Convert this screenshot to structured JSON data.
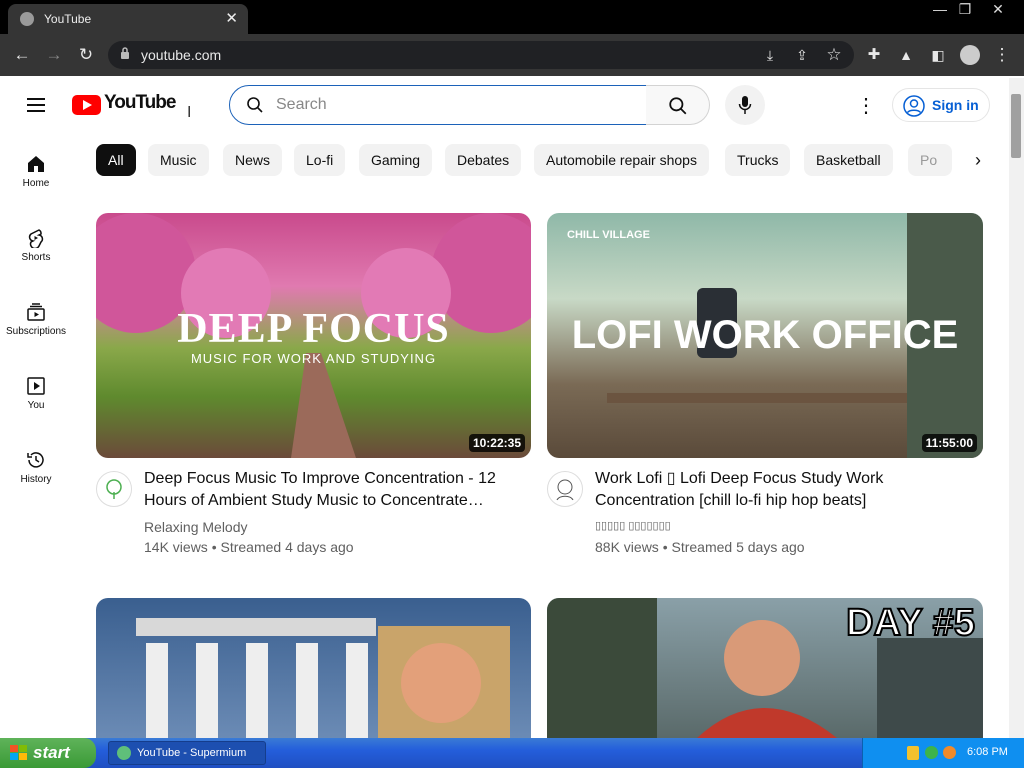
{
  "browser": {
    "tab_title": "YouTube",
    "tab_close": "✕",
    "window_controls": [
      "—",
      "❐",
      "✕"
    ],
    "url": "youtube.com"
  },
  "youtube": {
    "logo_text": "YouTube",
    "search_placeholder": "Search",
    "sign_in": "Sign in"
  },
  "sidebar": {
    "items": [
      {
        "label": "Home",
        "icon": "home-icon"
      },
      {
        "label": "Shorts",
        "icon": "shorts-icon"
      },
      {
        "label": "Subscriptions",
        "icon": "subscriptions-icon"
      },
      {
        "label": "You",
        "icon": "you-icon"
      },
      {
        "label": "History",
        "icon": "history-icon"
      }
    ]
  },
  "chips": [
    "All",
    "Music",
    "News",
    "Lo-fi",
    "Gaming",
    "Debates",
    "Automobile repair shops",
    "Trucks",
    "Basketball",
    "Po"
  ],
  "videos": [
    {
      "thumb_title": "DEEP FOCUS",
      "thumb_subtitle": "MUSIC FOR WORK AND STUDYING",
      "duration": "10:22:35",
      "title": "Deep Focus Music To Improve Concentration - 12 Hours of Ambient Study Music to Concentrate…",
      "channel": "Relaxing Melody",
      "meta": "14K views • Streamed 4 days ago"
    },
    {
      "thumb_title": "LOFI WORK OFFICE",
      "thumb_badge": "CHILL VILLAGE",
      "duration": "11:55:00",
      "title": "Work Lofi ▯ Lofi Deep Focus Study Work Concentration [chill lo-fi hip hop beats]",
      "channel": "▯▯▯▯▯ ▯▯▯▯▯▯▯",
      "meta": "88K views • Streamed 5 days ago"
    },
    {
      "thumb_title": ""
    },
    {
      "thumb_title": "DAY #5"
    }
  ],
  "taskbar": {
    "start": "start",
    "task": "YouTube - Supermium",
    "clock": "6:08 PM"
  },
  "colors": {
    "brand": "#ff0000",
    "link": "#065fd4",
    "taskbar": "#245edb"
  }
}
